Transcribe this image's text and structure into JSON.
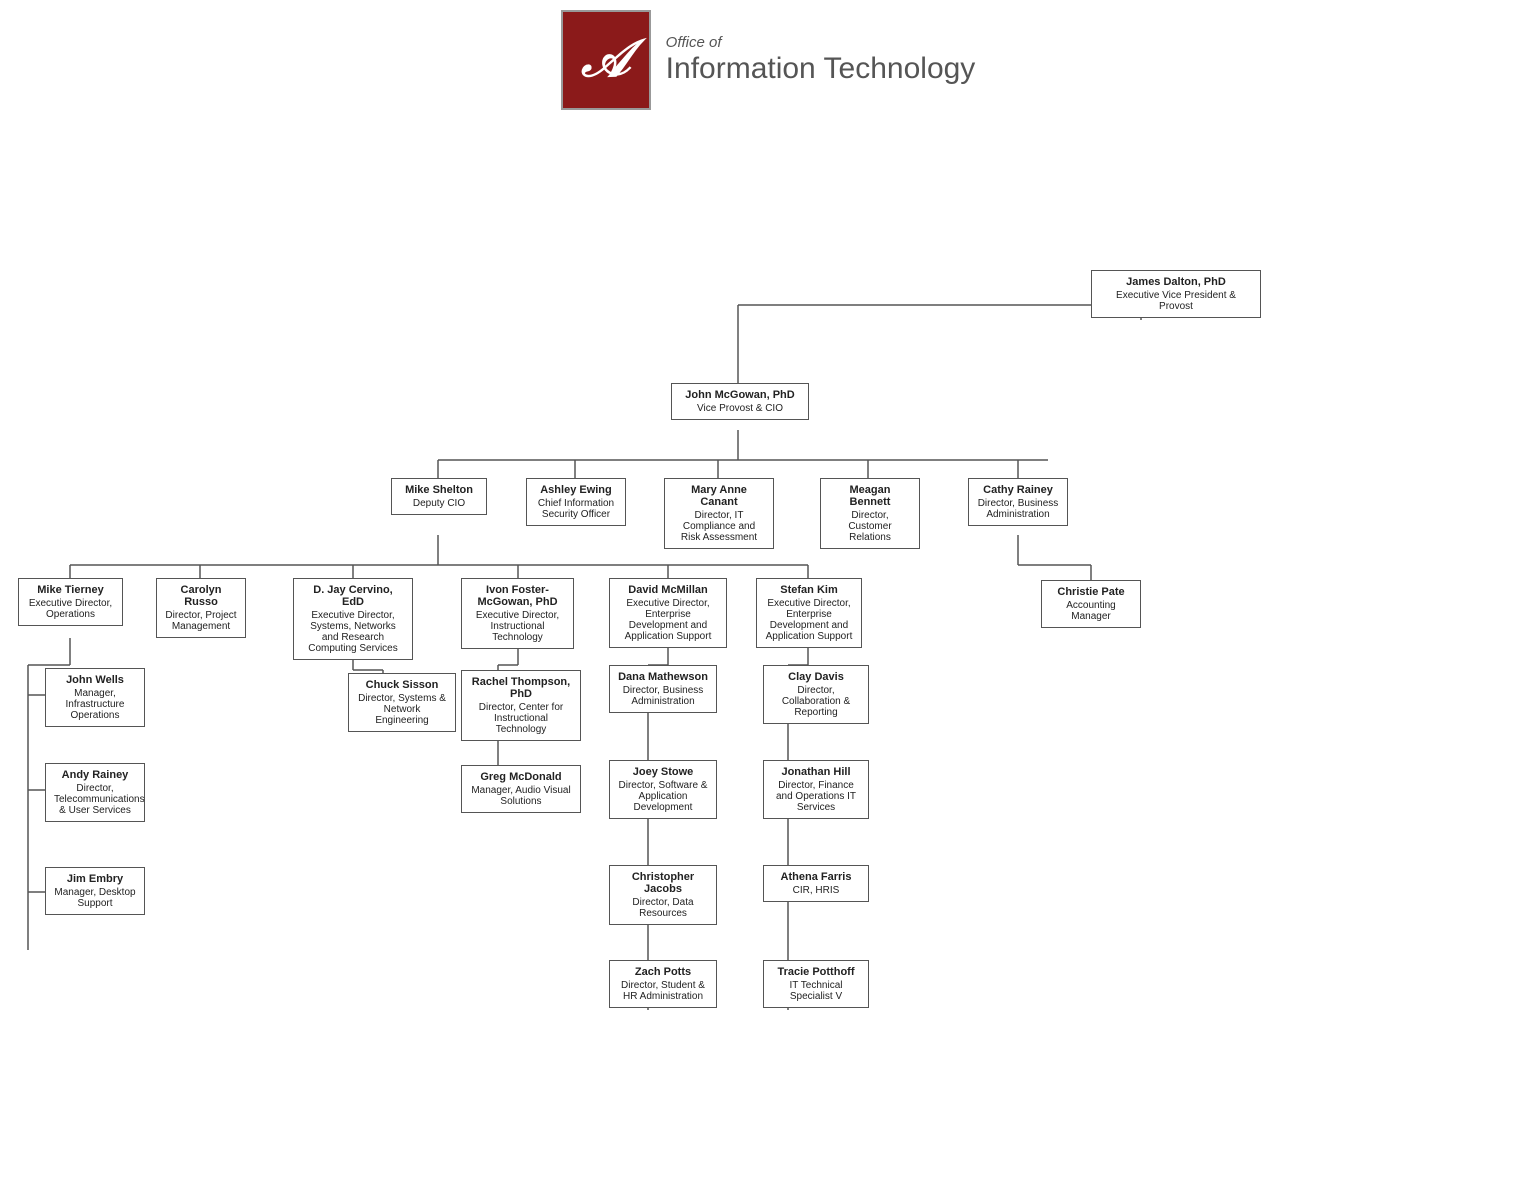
{
  "header": {
    "office_of": "Office of",
    "it_name": "Information Technology"
  },
  "nodes": {
    "james_dalton": {
      "name": "James Dalton, PhD",
      "title": "Executive Vice President &\nProvost"
    },
    "john_mcgowan": {
      "name": "John McGowan, PhD",
      "title": "Vice Provost & CIO"
    },
    "mike_shelton": {
      "name": "Mike Shelton",
      "title": "Deputy CIO"
    },
    "ashley_ewing": {
      "name": "Ashley Ewing",
      "title": "Chief Information Security Officer"
    },
    "mary_anne_canant": {
      "name": "Mary Anne Canant",
      "title": "Director, IT Compliance and Risk Assessment"
    },
    "meagan_bennett": {
      "name": "Meagan Bennett",
      "title": "Director, Customer Relations"
    },
    "cathy_rainey": {
      "name": "Cathy Rainey",
      "title": "Director, Business Administration"
    },
    "mike_tierney": {
      "name": "Mike Tierney",
      "title": "Executive Director, Operations"
    },
    "carolyn_russo": {
      "name": "Carolyn Russo",
      "title": "Director, Project Management"
    },
    "d_jay_cervino": {
      "name": "D. Jay Cervino, EdD",
      "title": "Executive Director, Systems, Networks and Research Computing Services"
    },
    "ivon_foster_mcgowan": {
      "name": "Ivon Foster-McGowan, PhD",
      "title": "Executive Director, Instructional Technology"
    },
    "david_mcmillan": {
      "name": "David McMillan",
      "title": "Executive Director, Enterprise Development and Application Support"
    },
    "stefan_kim": {
      "name": "Stefan Kim",
      "title": "Executive Director, Enterprise Development and Application Support"
    },
    "christie_pate": {
      "name": "Christie Pate",
      "title": "Accounting Manager"
    },
    "john_wells": {
      "name": "John Wells",
      "title": "Manager, Infrastructure Operations"
    },
    "andy_rainey": {
      "name": "Andy Rainey",
      "title": "Director, Telecommunications & User Services"
    },
    "jim_embry": {
      "name": "Jim Embry",
      "title": "Manager, Desktop Support"
    },
    "chuck_sisson": {
      "name": "Chuck Sisson",
      "title": "Director, Systems & Network Engineering"
    },
    "rachel_thompson": {
      "name": "Rachel Thompson, PhD",
      "title": "Director, Center for Instructional Technology"
    },
    "greg_mcdonald": {
      "name": "Greg McDonald",
      "title": "Manager, Audio Visual Solutions"
    },
    "dana_mathewson": {
      "name": "Dana Mathewson",
      "title": "Director, Business Administration"
    },
    "joey_stowe": {
      "name": "Joey Stowe",
      "title": "Director, Software & Application Development"
    },
    "christopher_jacobs": {
      "name": "Christopher Jacobs",
      "title": "Director, Data Resources"
    },
    "zach_potts": {
      "name": "Zach Potts",
      "title": "Director, Student & HR Administration"
    },
    "clay_davis": {
      "name": "Clay Davis",
      "title": "Director, Collaboration & Reporting"
    },
    "jonathan_hill": {
      "name": "Jonathan Hill",
      "title": "Director, Finance and Operations IT Services"
    },
    "athena_farris": {
      "name": "Athena Farris",
      "title": "CIR, HRIS"
    },
    "tracie_potthoff": {
      "name": "Tracie Potthoff",
      "title": "IT Technical Specialist V"
    }
  }
}
